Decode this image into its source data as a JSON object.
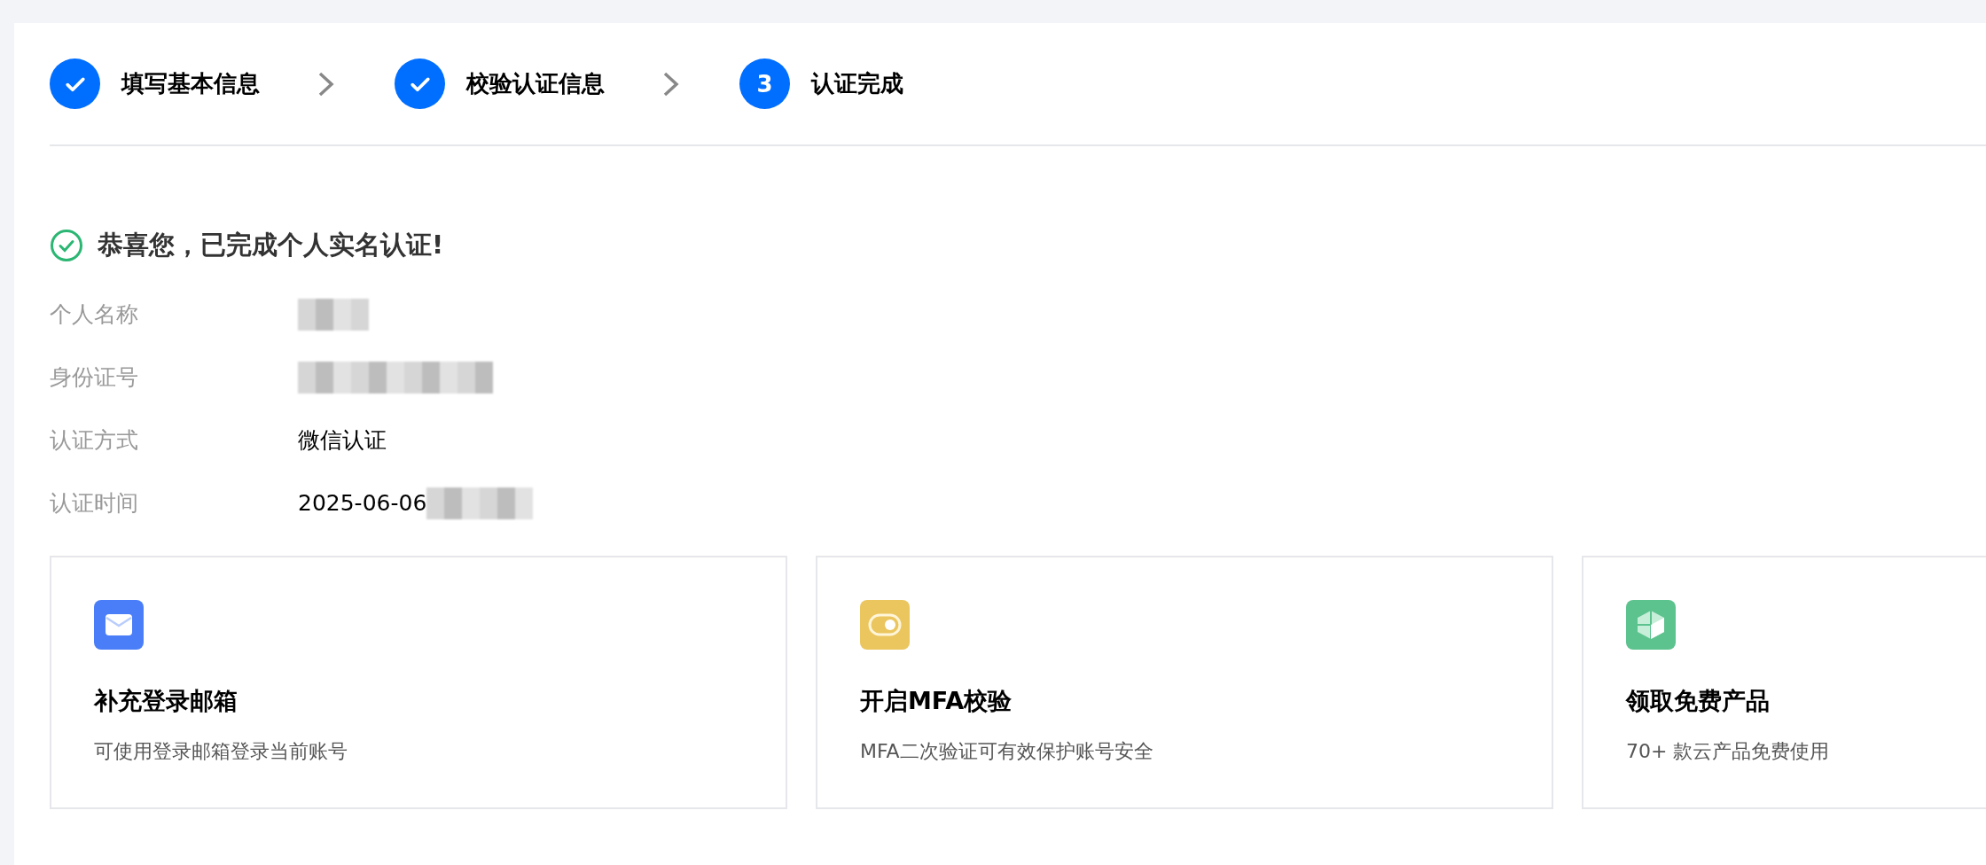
{
  "steps": [
    {
      "label": "填写基本信息",
      "done": true
    },
    {
      "label": "校验认证信息",
      "done": true
    },
    {
      "label": "认证完成",
      "done": false,
      "number": "3"
    }
  ],
  "result": {
    "title": "恭喜您，已完成个人实名认证!"
  },
  "details": [
    {
      "label": "个人名称",
      "redacted": true
    },
    {
      "label": "身份证号",
      "redacted": true
    },
    {
      "label": "认证方式",
      "value": "微信认证",
      "redacted": false
    },
    {
      "label": "认证时间",
      "value": "2025-06-06",
      "redacted": true
    }
  ],
  "cards": [
    {
      "kind": "mail",
      "color": "#4a7ef8",
      "title": "补充登录邮箱",
      "description": "可使用登录邮箱登录当前账号"
    },
    {
      "kind": "toggle",
      "color": "#ebc65f",
      "title": "开启MFA校验",
      "description": "MFA二次验证可有效保护账号安全"
    },
    {
      "kind": "box",
      "color": "#5cc28e",
      "title": "领取免费产品",
      "description": "70+ 款云产品免费使用"
    }
  ]
}
